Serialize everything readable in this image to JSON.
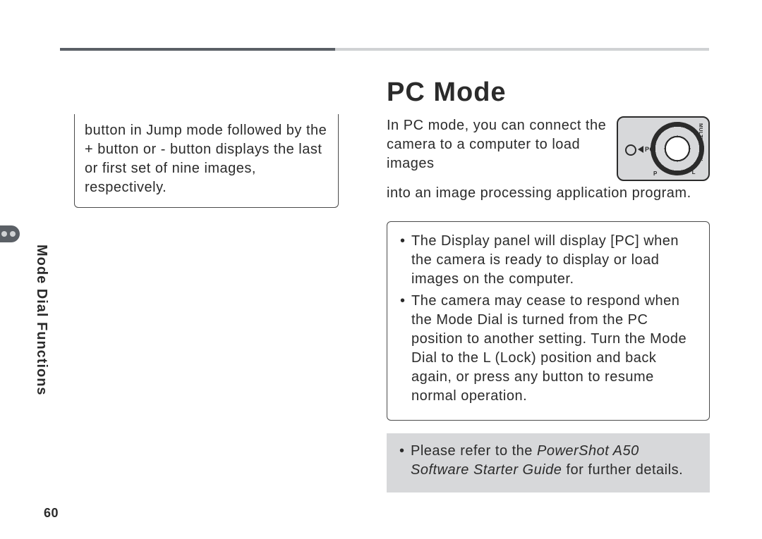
{
  "page_number": "60",
  "side_label": "Mode Dial Functions",
  "left_box_text": "button in Jump mode followed by the + button or - button displays the last or first set of nine images, respectively.",
  "heading": "PC Mode",
  "intro_part1": "In PC mode, you can connect the camera to a computer to load images",
  "intro_part2": "into an image processing application program.",
  "dial": {
    "pc": "PC",
    "multi": "MULTI",
    "play": "PLAY",
    "l": "L",
    "p": "P"
  },
  "bullets": [
    "The Display panel will display [PC] when the camera is ready to display or load images on the computer.",
    "The camera may cease to respond when the Mode Dial is turned from the PC position to another setting. Turn the Mode Dial to the L (Lock) position and back again, or press any button to resume normal operation."
  ],
  "note_prefix": "Please refer to the ",
  "note_italic": "PowerShot A50 Software Starter Guide",
  "note_suffix": " for further details."
}
